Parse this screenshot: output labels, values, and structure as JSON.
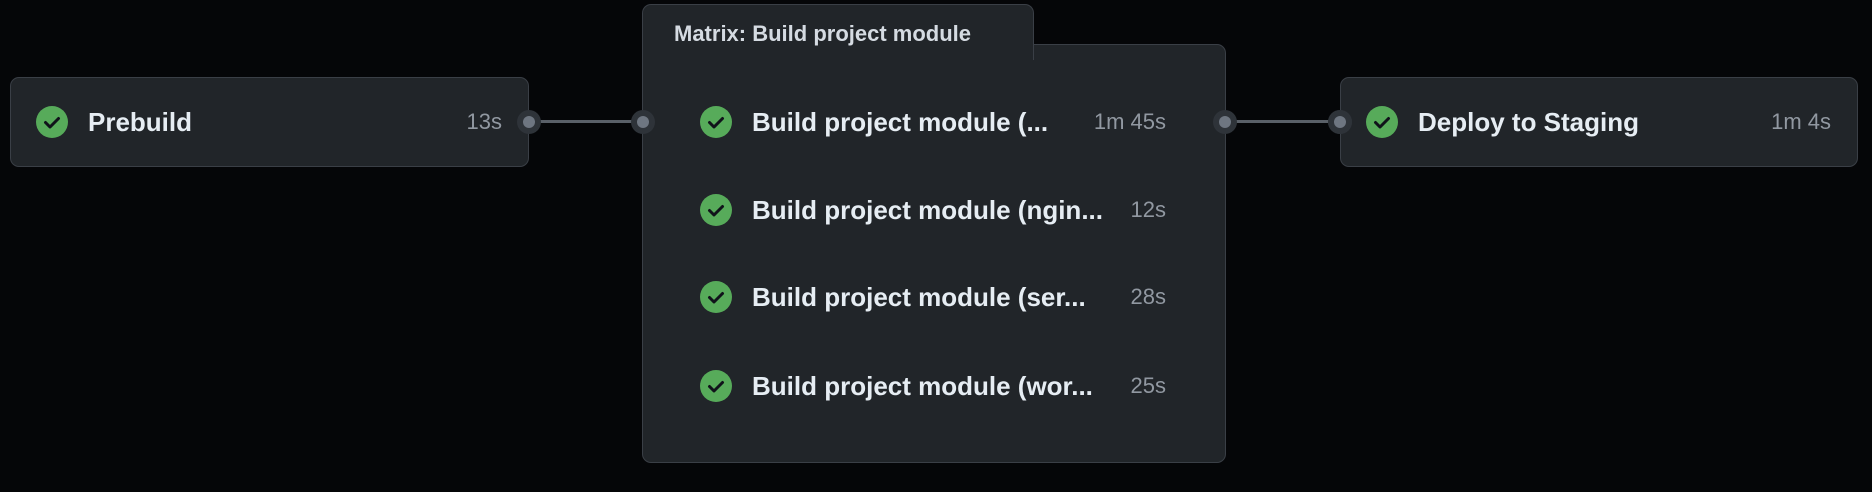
{
  "colors": {
    "background": "#050608",
    "card": "#212529",
    "border": "#3a3f46",
    "success": "#57ab5a",
    "text": "#e6edf3",
    "muted": "#9198a1"
  },
  "jobs": {
    "prebuild": {
      "name": "Prebuild",
      "duration": "13s",
      "status": "success",
      "icon": "check-circle-icon"
    },
    "deploy": {
      "name": "Deploy to Staging",
      "duration": "1m 4s",
      "status": "success",
      "icon": "check-circle-icon"
    }
  },
  "matrix": {
    "title": "Matrix: Build project module",
    "jobs": [
      {
        "name": "Build project module (...",
        "duration": "1m 45s",
        "status": "success"
      },
      {
        "name": "Build project module (ngin...",
        "duration": "12s",
        "status": "success"
      },
      {
        "name": "Build project module (ser...",
        "duration": "28s",
        "status": "success"
      },
      {
        "name": "Build project module (wor...",
        "duration": "25s",
        "status": "success"
      }
    ]
  }
}
